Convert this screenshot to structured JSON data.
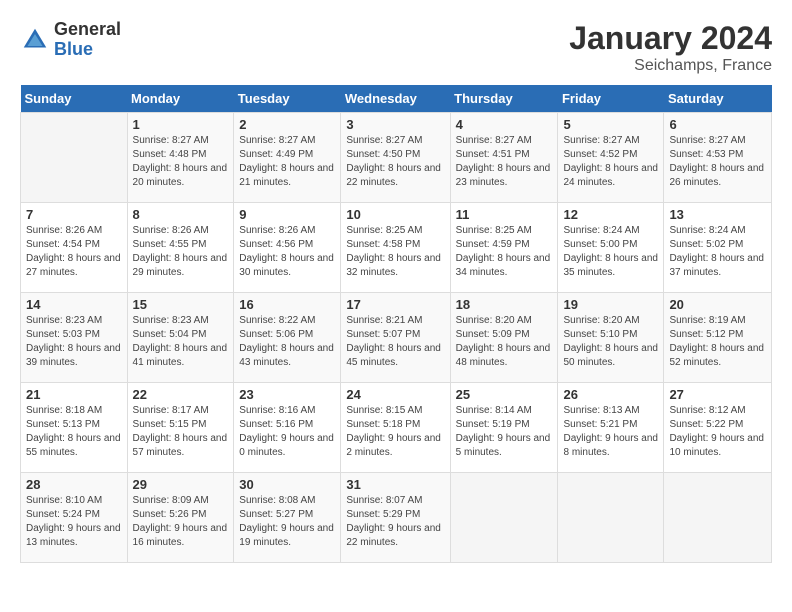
{
  "logo": {
    "general": "General",
    "blue": "Blue"
  },
  "title": "January 2024",
  "subtitle": "Seichamps, France",
  "days_header": [
    "Sunday",
    "Monday",
    "Tuesday",
    "Wednesday",
    "Thursday",
    "Friday",
    "Saturday"
  ],
  "weeks": [
    [
      {
        "day": "",
        "sunrise": "",
        "sunset": "",
        "daylight": ""
      },
      {
        "day": "1",
        "sunrise": "Sunrise: 8:27 AM",
        "sunset": "Sunset: 4:48 PM",
        "daylight": "Daylight: 8 hours and 20 minutes."
      },
      {
        "day": "2",
        "sunrise": "Sunrise: 8:27 AM",
        "sunset": "Sunset: 4:49 PM",
        "daylight": "Daylight: 8 hours and 21 minutes."
      },
      {
        "day": "3",
        "sunrise": "Sunrise: 8:27 AM",
        "sunset": "Sunset: 4:50 PM",
        "daylight": "Daylight: 8 hours and 22 minutes."
      },
      {
        "day": "4",
        "sunrise": "Sunrise: 8:27 AM",
        "sunset": "Sunset: 4:51 PM",
        "daylight": "Daylight: 8 hours and 23 minutes."
      },
      {
        "day": "5",
        "sunrise": "Sunrise: 8:27 AM",
        "sunset": "Sunset: 4:52 PM",
        "daylight": "Daylight: 8 hours and 24 minutes."
      },
      {
        "day": "6",
        "sunrise": "Sunrise: 8:27 AM",
        "sunset": "Sunset: 4:53 PM",
        "daylight": "Daylight: 8 hours and 26 minutes."
      }
    ],
    [
      {
        "day": "7",
        "sunrise": "Sunrise: 8:26 AM",
        "sunset": "Sunset: 4:54 PM",
        "daylight": "Daylight: 8 hours and 27 minutes."
      },
      {
        "day": "8",
        "sunrise": "Sunrise: 8:26 AM",
        "sunset": "Sunset: 4:55 PM",
        "daylight": "Daylight: 8 hours and 29 minutes."
      },
      {
        "day": "9",
        "sunrise": "Sunrise: 8:26 AM",
        "sunset": "Sunset: 4:56 PM",
        "daylight": "Daylight: 8 hours and 30 minutes."
      },
      {
        "day": "10",
        "sunrise": "Sunrise: 8:25 AM",
        "sunset": "Sunset: 4:58 PM",
        "daylight": "Daylight: 8 hours and 32 minutes."
      },
      {
        "day": "11",
        "sunrise": "Sunrise: 8:25 AM",
        "sunset": "Sunset: 4:59 PM",
        "daylight": "Daylight: 8 hours and 34 minutes."
      },
      {
        "day": "12",
        "sunrise": "Sunrise: 8:24 AM",
        "sunset": "Sunset: 5:00 PM",
        "daylight": "Daylight: 8 hours and 35 minutes."
      },
      {
        "day": "13",
        "sunrise": "Sunrise: 8:24 AM",
        "sunset": "Sunset: 5:02 PM",
        "daylight": "Daylight: 8 hours and 37 minutes."
      }
    ],
    [
      {
        "day": "14",
        "sunrise": "Sunrise: 8:23 AM",
        "sunset": "Sunset: 5:03 PM",
        "daylight": "Daylight: 8 hours and 39 minutes."
      },
      {
        "day": "15",
        "sunrise": "Sunrise: 8:23 AM",
        "sunset": "Sunset: 5:04 PM",
        "daylight": "Daylight: 8 hours and 41 minutes."
      },
      {
        "day": "16",
        "sunrise": "Sunrise: 8:22 AM",
        "sunset": "Sunset: 5:06 PM",
        "daylight": "Daylight: 8 hours and 43 minutes."
      },
      {
        "day": "17",
        "sunrise": "Sunrise: 8:21 AM",
        "sunset": "Sunset: 5:07 PM",
        "daylight": "Daylight: 8 hours and 45 minutes."
      },
      {
        "day": "18",
        "sunrise": "Sunrise: 8:20 AM",
        "sunset": "Sunset: 5:09 PM",
        "daylight": "Daylight: 8 hours and 48 minutes."
      },
      {
        "day": "19",
        "sunrise": "Sunrise: 8:20 AM",
        "sunset": "Sunset: 5:10 PM",
        "daylight": "Daylight: 8 hours and 50 minutes."
      },
      {
        "day": "20",
        "sunrise": "Sunrise: 8:19 AM",
        "sunset": "Sunset: 5:12 PM",
        "daylight": "Daylight: 8 hours and 52 minutes."
      }
    ],
    [
      {
        "day": "21",
        "sunrise": "Sunrise: 8:18 AM",
        "sunset": "Sunset: 5:13 PM",
        "daylight": "Daylight: 8 hours and 55 minutes."
      },
      {
        "day": "22",
        "sunrise": "Sunrise: 8:17 AM",
        "sunset": "Sunset: 5:15 PM",
        "daylight": "Daylight: 8 hours and 57 minutes."
      },
      {
        "day": "23",
        "sunrise": "Sunrise: 8:16 AM",
        "sunset": "Sunset: 5:16 PM",
        "daylight": "Daylight: 9 hours and 0 minutes."
      },
      {
        "day": "24",
        "sunrise": "Sunrise: 8:15 AM",
        "sunset": "Sunset: 5:18 PM",
        "daylight": "Daylight: 9 hours and 2 minutes."
      },
      {
        "day": "25",
        "sunrise": "Sunrise: 8:14 AM",
        "sunset": "Sunset: 5:19 PM",
        "daylight": "Daylight: 9 hours and 5 minutes."
      },
      {
        "day": "26",
        "sunrise": "Sunrise: 8:13 AM",
        "sunset": "Sunset: 5:21 PM",
        "daylight": "Daylight: 9 hours and 8 minutes."
      },
      {
        "day": "27",
        "sunrise": "Sunrise: 8:12 AM",
        "sunset": "Sunset: 5:22 PM",
        "daylight": "Daylight: 9 hours and 10 minutes."
      }
    ],
    [
      {
        "day": "28",
        "sunrise": "Sunrise: 8:10 AM",
        "sunset": "Sunset: 5:24 PM",
        "daylight": "Daylight: 9 hours and 13 minutes."
      },
      {
        "day": "29",
        "sunrise": "Sunrise: 8:09 AM",
        "sunset": "Sunset: 5:26 PM",
        "daylight": "Daylight: 9 hours and 16 minutes."
      },
      {
        "day": "30",
        "sunrise": "Sunrise: 8:08 AM",
        "sunset": "Sunset: 5:27 PM",
        "daylight": "Daylight: 9 hours and 19 minutes."
      },
      {
        "day": "31",
        "sunrise": "Sunrise: 8:07 AM",
        "sunset": "Sunset: 5:29 PM",
        "daylight": "Daylight: 9 hours and 22 minutes."
      },
      {
        "day": "",
        "sunrise": "",
        "sunset": "",
        "daylight": ""
      },
      {
        "day": "",
        "sunrise": "",
        "sunset": "",
        "daylight": ""
      },
      {
        "day": "",
        "sunrise": "",
        "sunset": "",
        "daylight": ""
      }
    ]
  ]
}
